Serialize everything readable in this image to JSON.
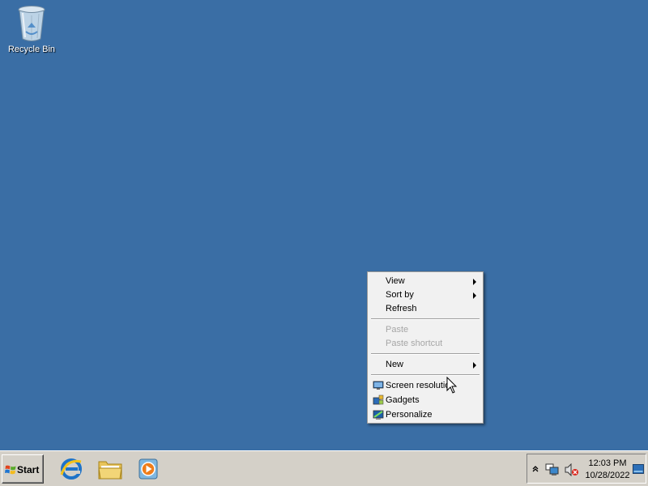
{
  "desktop": {
    "background_color": "#3a6ea5",
    "icons": [
      {
        "label": "Recycle Bin",
        "icon": "recycle-bin-icon"
      }
    ]
  },
  "context_menu": {
    "items": [
      {
        "label": "View",
        "submenu": true,
        "disabled": false
      },
      {
        "label": "Sort by",
        "submenu": true,
        "disabled": false
      },
      {
        "label": "Refresh",
        "submenu": false,
        "disabled": false
      },
      {
        "label": "Paste",
        "submenu": false,
        "disabled": true
      },
      {
        "label": "Paste shortcut",
        "submenu": false,
        "disabled": true
      },
      {
        "label": "New",
        "submenu": true,
        "disabled": false
      },
      {
        "label": "Screen resolution",
        "icon": "screen-resolution-icon",
        "disabled": false
      },
      {
        "label": "Gadgets",
        "icon": "gadgets-icon",
        "disabled": false
      },
      {
        "label": "Personalize",
        "icon": "personalize-icon",
        "disabled": false
      }
    ]
  },
  "taskbar": {
    "start_label": "Start",
    "pinned_apps": [
      {
        "name": "Internet Explorer",
        "icon": "internet-explorer-icon"
      },
      {
        "name": "Windows Explorer",
        "icon": "folder-icon"
      },
      {
        "name": "Windows Media Player",
        "icon": "media-player-icon"
      }
    ],
    "tray": {
      "time": "12:03 PM",
      "date": "10/28/2022",
      "icons": [
        "show-hidden-icons-chevron",
        "network-icon",
        "volume-muted-icon",
        "show-desktop-icon"
      ]
    }
  }
}
